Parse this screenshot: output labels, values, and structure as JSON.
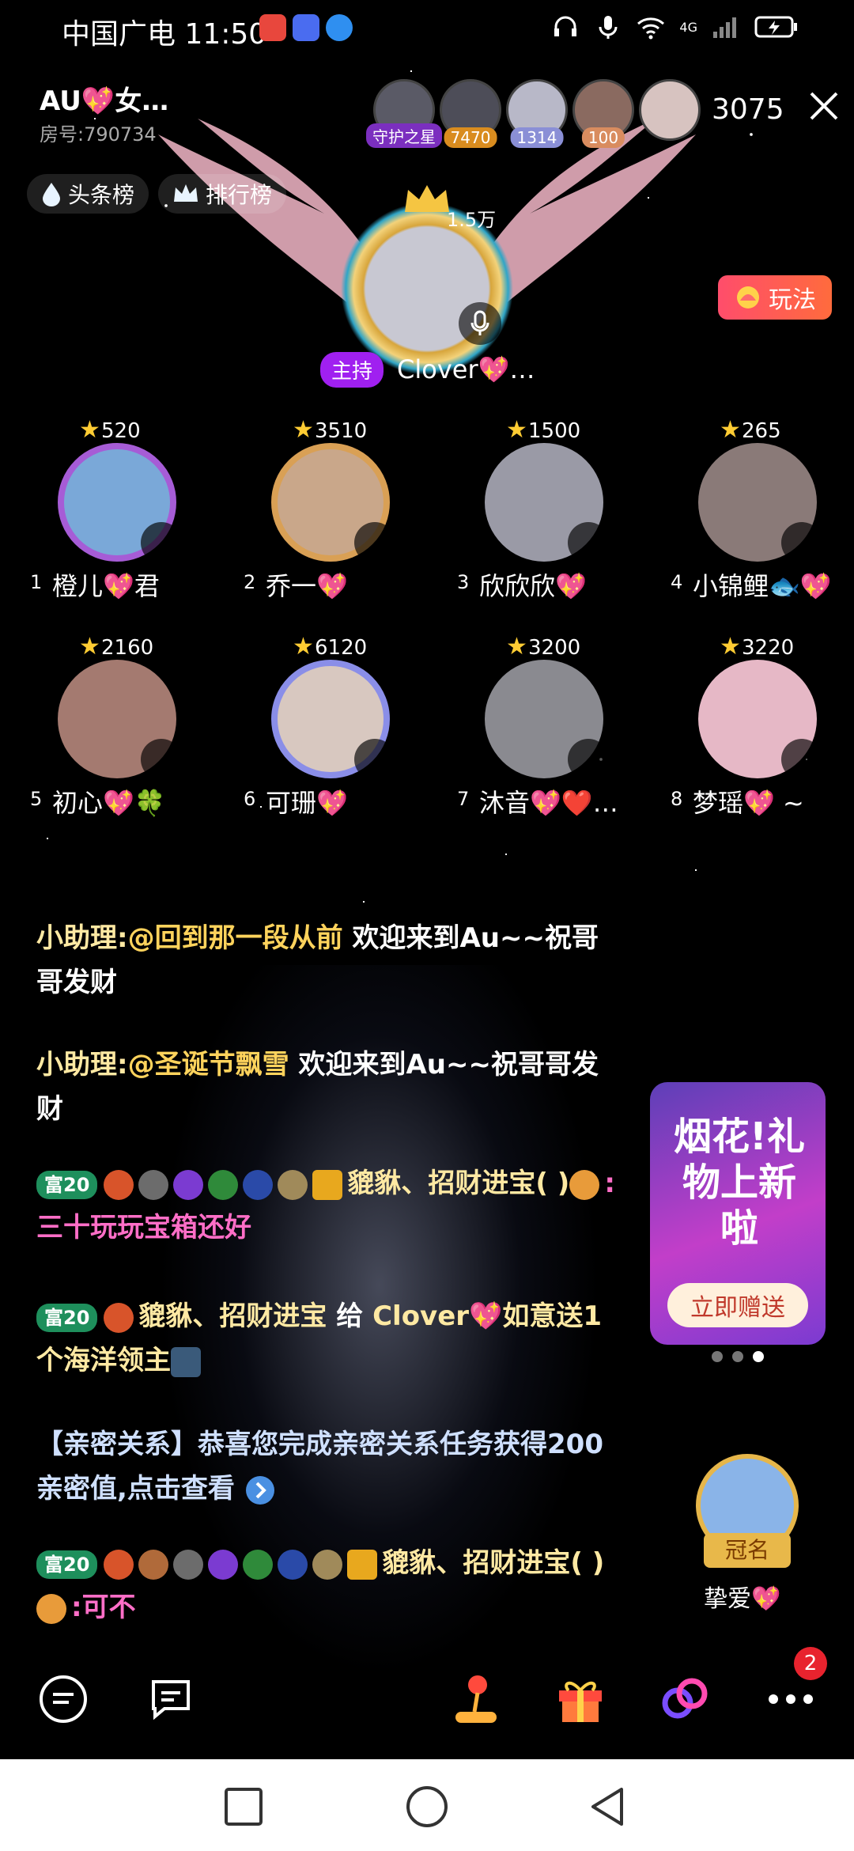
{
  "status_bar": {
    "carrier_time": "中国广电 11:50",
    "network": "4G"
  },
  "header": {
    "room_title": "AU💖女…",
    "room_id": "房号:790734",
    "viewers": [
      {
        "badge": "守护之星",
        "badge_color": "#7b2fbf"
      },
      {
        "badge": "7470",
        "badge_color": "#d98c1f"
      },
      {
        "badge": "1314",
        "badge_color": "#8a8fd6"
      },
      {
        "badge": "100",
        "badge_color": "#d98c5f"
      },
      {
        "badge": "",
        "badge_color": ""
      }
    ],
    "viewer_count": "3075",
    "headline_label": "头条榜",
    "ranking_label": "排行榜"
  },
  "host": {
    "count": "1.5万",
    "tag": "主持",
    "name": "Clover💖…",
    "play_label": "玩法"
  },
  "seats": [
    {
      "num": "1",
      "name": "橙儿💖君",
      "score": "520"
    },
    {
      "num": "2",
      "name": "乔一💖",
      "score": "3510"
    },
    {
      "num": "3",
      "name": "欣欣欣💖",
      "score": "1500"
    },
    {
      "num": "4",
      "name": "小锦鲤🐟💖",
      "score": "265"
    },
    {
      "num": "5",
      "name": "初心💖🍀",
      "score": "2160"
    },
    {
      "num": "6",
      "name": "可珊💖",
      "score": "6120"
    },
    {
      "num": "7",
      "name": "沐音💖❤️…",
      "score": "3200"
    },
    {
      "num": "8",
      "name": "梦瑶💖 ~",
      "score": "3220"
    }
  ],
  "chat": {
    "msg1": {
      "prefix": "小助理:",
      "mention": "@回到那一段从前",
      "text": " 欢迎来到Au~~祝哥哥发财"
    },
    "msg2": {
      "prefix": "小助理:",
      "mention": "@圣诞节飘雪",
      "text": " 欢迎来到Au~~祝哥哥发财"
    },
    "msg3": {
      "level": "富20",
      "user": "貔貅、招财进宝(  )",
      "colon": ":",
      "text": "三十玩玩宝箱还好"
    },
    "msg4": {
      "level": "富20",
      "user": "貔貅、招财进宝",
      "action": " 给 ",
      "target": "Clover💖",
      "text": "如意送1个海洋领主"
    },
    "msg5": {
      "text": "【亲密关系】恭喜您完成亲密关系任务获得200亲密值,点击查看"
    },
    "msg6": {
      "level": "富20",
      "user": "貔貅、招财进宝(  )",
      "colon": ":",
      "text": "可不"
    }
  },
  "promo": {
    "title": "烟花!礼物上新啦",
    "button": "立即赠送"
  },
  "crown": {
    "tag": "冠名",
    "name": "挚爱💖"
  },
  "bottom_bar": {
    "notification_count": "2"
  }
}
